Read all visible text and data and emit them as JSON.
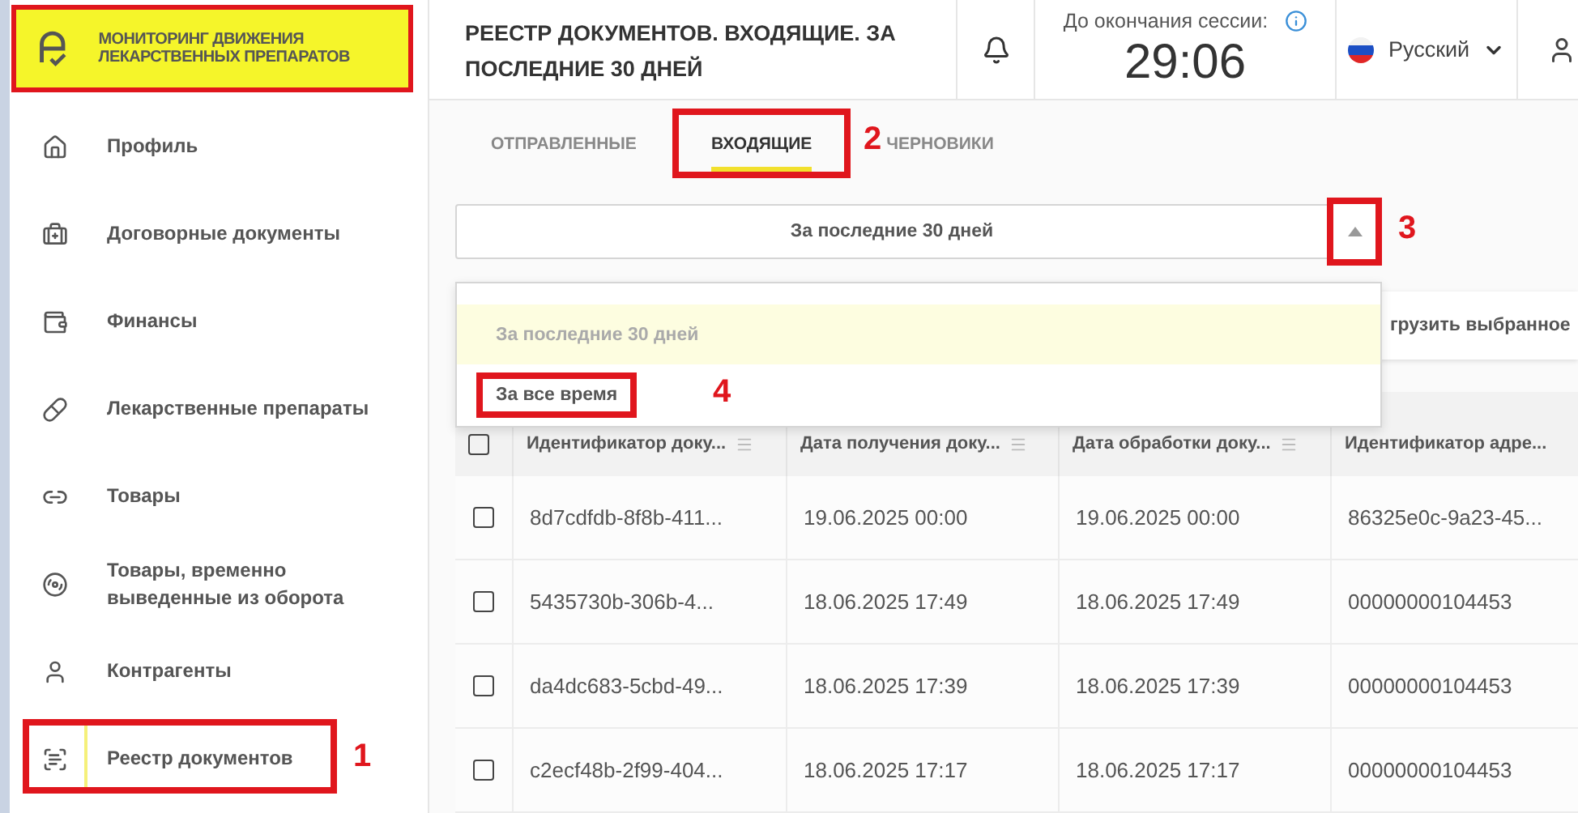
{
  "logo": {
    "text": "МОНИТОРИНГ ДВИЖЕНИЯ ЛЕКАРСТВЕННЫХ ПРЕПАРАТОВ",
    "annotated": true
  },
  "sidebar": {
    "items": [
      {
        "label": "Профиль",
        "selected": false
      },
      {
        "label": "Договорные документы",
        "selected": false
      },
      {
        "label": "Финансы",
        "selected": false
      },
      {
        "label": "Лекарственные препараты",
        "selected": false
      },
      {
        "label": "Товары",
        "selected": false
      },
      {
        "label": "Товары, временно выведенные из оборота",
        "selected": false
      },
      {
        "label": "Контрагенты",
        "selected": false
      },
      {
        "label": "Реестр документов",
        "selected": true,
        "annotation": "1"
      }
    ]
  },
  "header": {
    "title": "РЕЕСТР ДОКУМЕНТОВ. ВХОДЯЩИЕ. ЗА ПОСЛЕДНИЕ 30 ДНЕЙ",
    "session_label": "До окончания сессии:",
    "timer": "29:06",
    "language": "Русский"
  },
  "tabs": [
    {
      "label": "ОТПРАВЛЕННЫЕ",
      "selected": false
    },
    {
      "label": "ВХОДЯЩИЕ",
      "selected": true,
      "annotation": "2"
    },
    {
      "label": "ЧЕРНОВИКИ",
      "selected": false
    }
  ],
  "period_select": {
    "value": "За последние 30 дней",
    "expanded": true,
    "annotation": "3",
    "options": [
      {
        "label": "За последние 30 дней",
        "selected": true
      },
      {
        "label": "За все время",
        "selected": false,
        "annotation": "4"
      }
    ]
  },
  "export_button": "грузить выбранное",
  "table": {
    "all_checked": false,
    "columns": [
      "Идентификатор доку...",
      "Дата получения доку...",
      "Дата обработки доку...",
      "Идентификатор адре..."
    ],
    "rows": [
      {
        "checked": false,
        "cells": [
          "8d7cdfdb-8f8b-411...",
          "19.06.2025 00:00",
          "19.06.2025 00:00",
          "86325e0c-9a23-45..."
        ]
      },
      {
        "checked": false,
        "cells": [
          "5435730b-306b-4...",
          "18.06.2025 17:49",
          "18.06.2025 17:49",
          "00000000104453"
        ]
      },
      {
        "checked": false,
        "cells": [
          "da4dc683-5cbd-49...",
          "18.06.2025 17:39",
          "18.06.2025 17:39",
          "00000000104453"
        ]
      },
      {
        "checked": false,
        "cells": [
          "c2ecf48b-2f99-404...",
          "18.06.2025 17:17",
          "18.06.2025 17:17",
          "00000000104453"
        ]
      }
    ]
  }
}
